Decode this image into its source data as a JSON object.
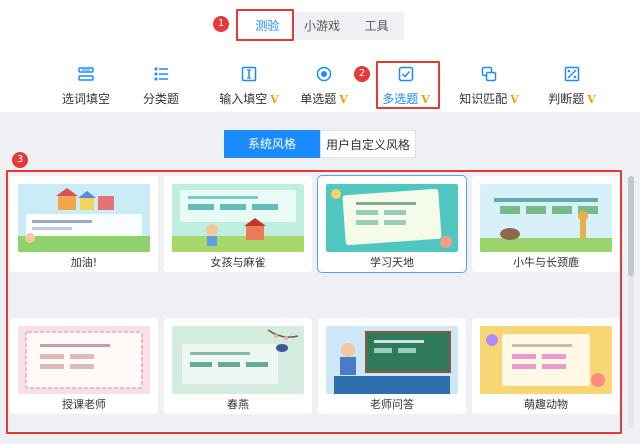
{
  "top_tabs": {
    "quiz": "测验",
    "minigame": "小游戏",
    "tools": "工具"
  },
  "badges": {
    "one": "1",
    "two": "2",
    "three": "3"
  },
  "question_types": [
    {
      "label": "选词填空",
      "vip": "",
      "icon": "word-fill-icon"
    },
    {
      "label": "分类题",
      "vip": "",
      "icon": "classify-icon"
    },
    {
      "label": "输入填空",
      "vip": "V",
      "icon": "input-fill-icon"
    },
    {
      "label": "单选题",
      "vip": "V",
      "icon": "radio-icon"
    },
    {
      "label": "多选题",
      "vip": "V",
      "icon": "checkbox-icon"
    },
    {
      "label": "知识匹配",
      "vip": "V",
      "icon": "match-icon"
    },
    {
      "label": "判断题",
      "vip": "V",
      "icon": "judge-icon"
    }
  ],
  "style_tabs": {
    "system": "系统风格",
    "custom": "用户自定义风格"
  },
  "templates": [
    {
      "label": "加油!"
    },
    {
      "label": "女孩与麻雀"
    },
    {
      "label": "学习天地"
    },
    {
      "label": "小牛与长颈鹿"
    },
    {
      "label": "授课老师"
    },
    {
      "label": "春燕"
    },
    {
      "label": "老师问答"
    },
    {
      "label": "萌趣动物"
    }
  ],
  "colors": {
    "accent": "#1a8cff",
    "annotation": "#e53935",
    "vip": "#e8a300"
  }
}
